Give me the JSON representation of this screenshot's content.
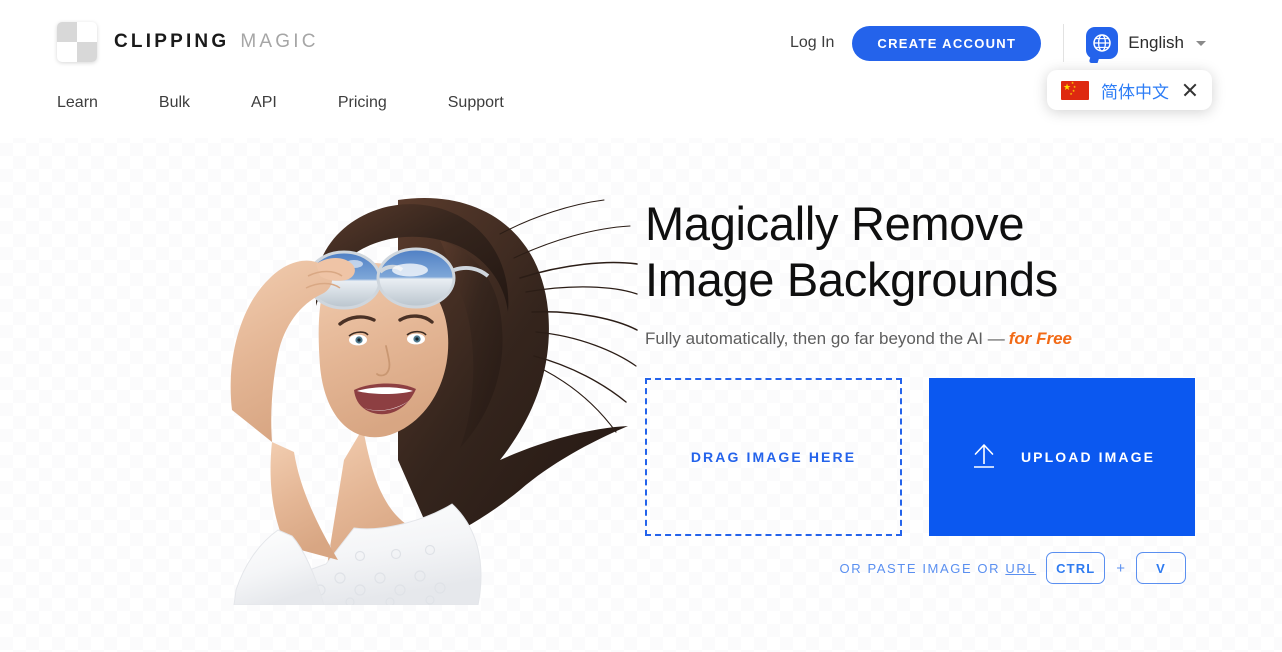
{
  "brand": {
    "word_bold": "CLIPPING",
    "word_light": "MAGIC",
    "mark_icon": "checkerboard-logo-icon"
  },
  "nav": {
    "items": [
      {
        "label": "Learn"
      },
      {
        "label": "Bulk"
      },
      {
        "label": "API"
      },
      {
        "label": "Pricing"
      },
      {
        "label": "Support"
      }
    ]
  },
  "header": {
    "login_label": "Log In",
    "create_account_label": "CREATE ACCOUNT",
    "language_label": "English",
    "globe_icon": "globe-speech-bubble-icon",
    "caret_icon": "chevron-down-icon",
    "accent_blue": "#2463eb"
  },
  "language_popup": {
    "flag_icon": "flag-china-icon",
    "label": "简体中文",
    "close_icon": "close-icon"
  },
  "hero": {
    "title": "Magically Remove\nImage Backgrounds",
    "subtitle_prefix": "Fully automatically, then go far beyond the AI —",
    "subtitle_highlight": "for Free",
    "highlight_color": "#f26a16",
    "photo_alt": "woman-with-sunglasses-cutout"
  },
  "actions": {
    "dropzone_label": "DRAG IMAGE HERE",
    "upload_label": "UPLOAD IMAGE",
    "upload_icon": "upload-arrow-icon",
    "upload_bg": "#0b58f0"
  },
  "paste": {
    "text_before": "OR PASTE IMAGE OR ",
    "link_label": "URL",
    "key_ctrl": "CTRL",
    "key_plus": "+",
    "key_v": "V"
  }
}
